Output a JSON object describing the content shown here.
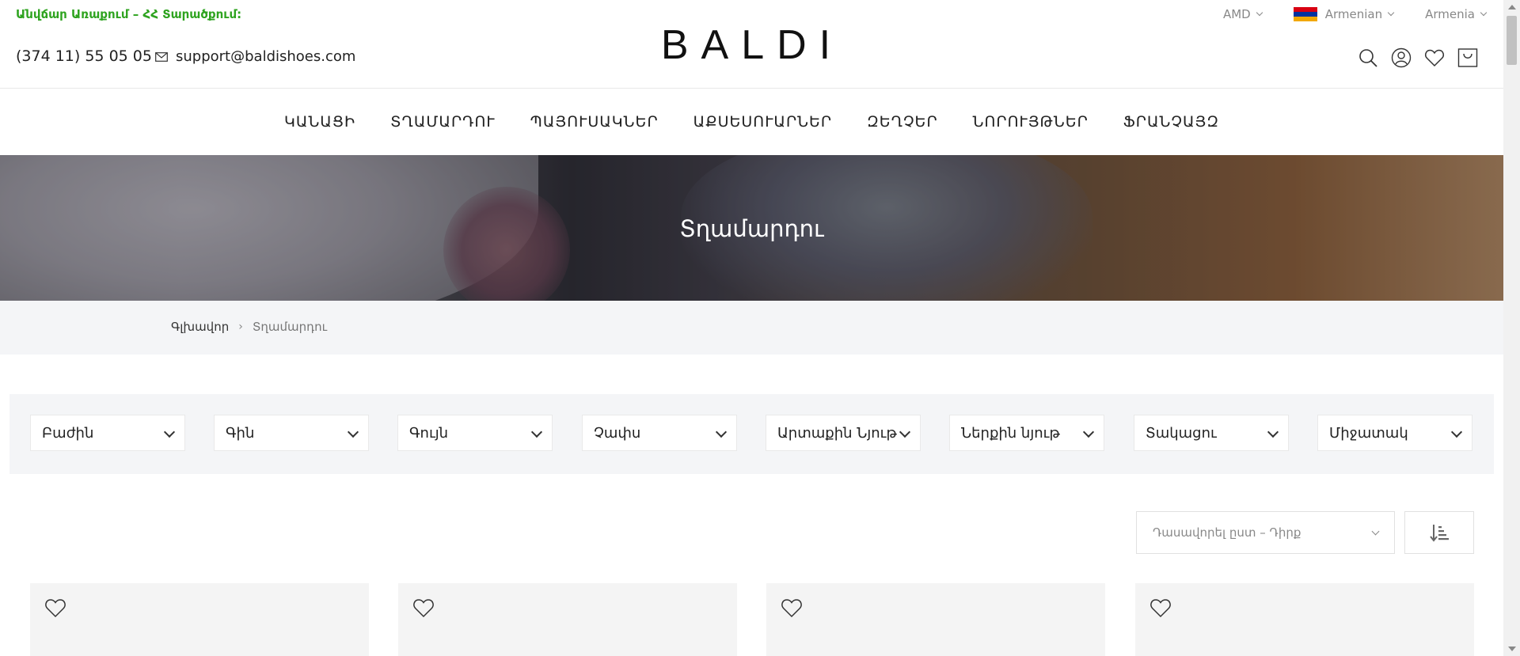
{
  "header": {
    "promo": "Անվճար Առաքում – ՀՀ Տարածքում:",
    "currency": "AMD",
    "language": "Armenian",
    "country": "Armenia",
    "phone": "(374 11) 55 05 05",
    "email": "support@baldishoes.com",
    "logo": "BALDI"
  },
  "nav": [
    {
      "label": "ԿԱՆԱՑԻ"
    },
    {
      "label": "ՏՂԱՄԱՐԴՈՒ"
    },
    {
      "label": "ՊԱՅՈՒՍԱԿՆԵՐ"
    },
    {
      "label": "ԱՔՍԵՍՈՒԱՐՆԵՐ"
    },
    {
      "label": "ԶԵՂՉԵՐ"
    },
    {
      "label": "ՆՈՐՈՒՅԹՆԵՐ"
    },
    {
      "label": "ՖՐԱՆՉԱՅԶ"
    }
  ],
  "banner": {
    "title": "Տղամարդու"
  },
  "breadcrumb": {
    "home": "Գլխավոր",
    "separator": "›",
    "current": "Տղամարդու"
  },
  "filters": [
    {
      "label": "Բաժին"
    },
    {
      "label": "Գին"
    },
    {
      "label": "Գույն"
    },
    {
      "label": "Չափս"
    },
    {
      "label": "Արտաքին Նյութ"
    },
    {
      "label": "Ներքին նյութ"
    },
    {
      "label": "Տակացու"
    },
    {
      "label": "Միջատակ"
    }
  ],
  "sort": {
    "label": "Դասավորել ըստ – Դիրք"
  },
  "colors": {
    "promo": "#2ea31f",
    "text": "#222222",
    "panel": "#f4f5f7"
  }
}
